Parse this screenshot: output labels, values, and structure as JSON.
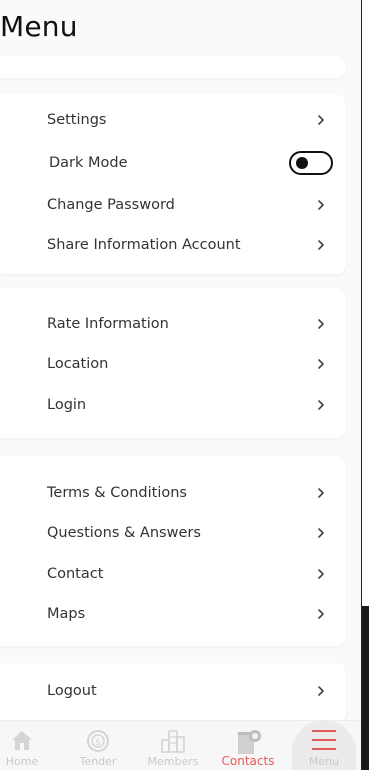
{
  "header": {
    "title": "Menu"
  },
  "sections": [
    {
      "items": [
        {
          "label": "Settings",
          "type": "chevron"
        },
        {
          "label": "Dark Mode",
          "type": "toggle",
          "toggle_on": false
        },
        {
          "label": "Change Password",
          "type": "chevron"
        },
        {
          "label": "Share Information Account",
          "type": "chevron"
        }
      ]
    },
    {
      "items": [
        {
          "label": "Rate Information",
          "type": "chevron"
        },
        {
          "label": "Location",
          "type": "chevron"
        },
        {
          "label": "Login",
          "type": "chevron"
        }
      ]
    },
    {
      "items": [
        {
          "label": "Terms & Conditions",
          "type": "chevron"
        },
        {
          "label": "Questions & Answers",
          "type": "chevron"
        },
        {
          "label": "Contact",
          "type": "chevron"
        },
        {
          "label": "Maps",
          "type": "chevron"
        }
      ]
    },
    {
      "items": [
        {
          "label": "Logout",
          "type": "chevron"
        }
      ]
    }
  ],
  "tabbar": {
    "tabs": [
      {
        "label": "Home",
        "icon": "home-icon"
      },
      {
        "label": "Tender",
        "icon": "tender-icon"
      },
      {
        "label": "Members",
        "icon": "members-icon"
      },
      {
        "label": "Contacts",
        "icon": "contacts-icon",
        "active": true
      },
      {
        "label": "Menu",
        "icon": "hamburger-menu-icon"
      }
    ]
  },
  "colors": {
    "accent": "#e45a5a",
    "inactive": "#c9c9c9",
    "background": "#fafafa"
  }
}
